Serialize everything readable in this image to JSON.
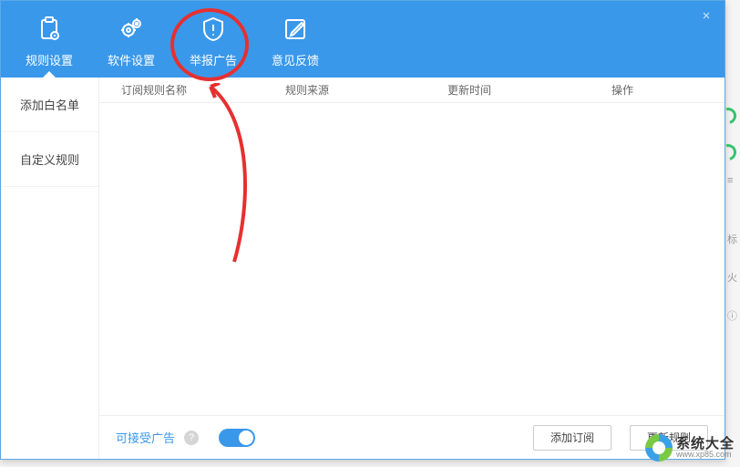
{
  "nav": {
    "items": [
      {
        "label": "规则设置",
        "icon": "clipboard-settings"
      },
      {
        "label": "软件设置",
        "icon": "gears"
      },
      {
        "label": "举报广告",
        "icon": "shield-alert"
      },
      {
        "label": "意见反馈",
        "icon": "edit-square"
      }
    ],
    "active_index": 0
  },
  "sidebar": {
    "items": [
      {
        "label": "添加白名单"
      },
      {
        "label": "自定义规则"
      }
    ],
    "active_index": 0
  },
  "table": {
    "headers": {
      "name": "订阅规则名称",
      "source": "规则来源",
      "time": "更新时间",
      "op": "操作"
    },
    "rows": []
  },
  "footer": {
    "accept_label": "可接受广告",
    "toggle_on": true,
    "add_button": "添加订阅",
    "update_button": "更新规则"
  },
  "annotation": {
    "highlight_nav_index": 2,
    "circle_color": "#e63030"
  },
  "watermark": {
    "title": "系统大全",
    "url": "www.xp85.com"
  },
  "close_label": "×"
}
